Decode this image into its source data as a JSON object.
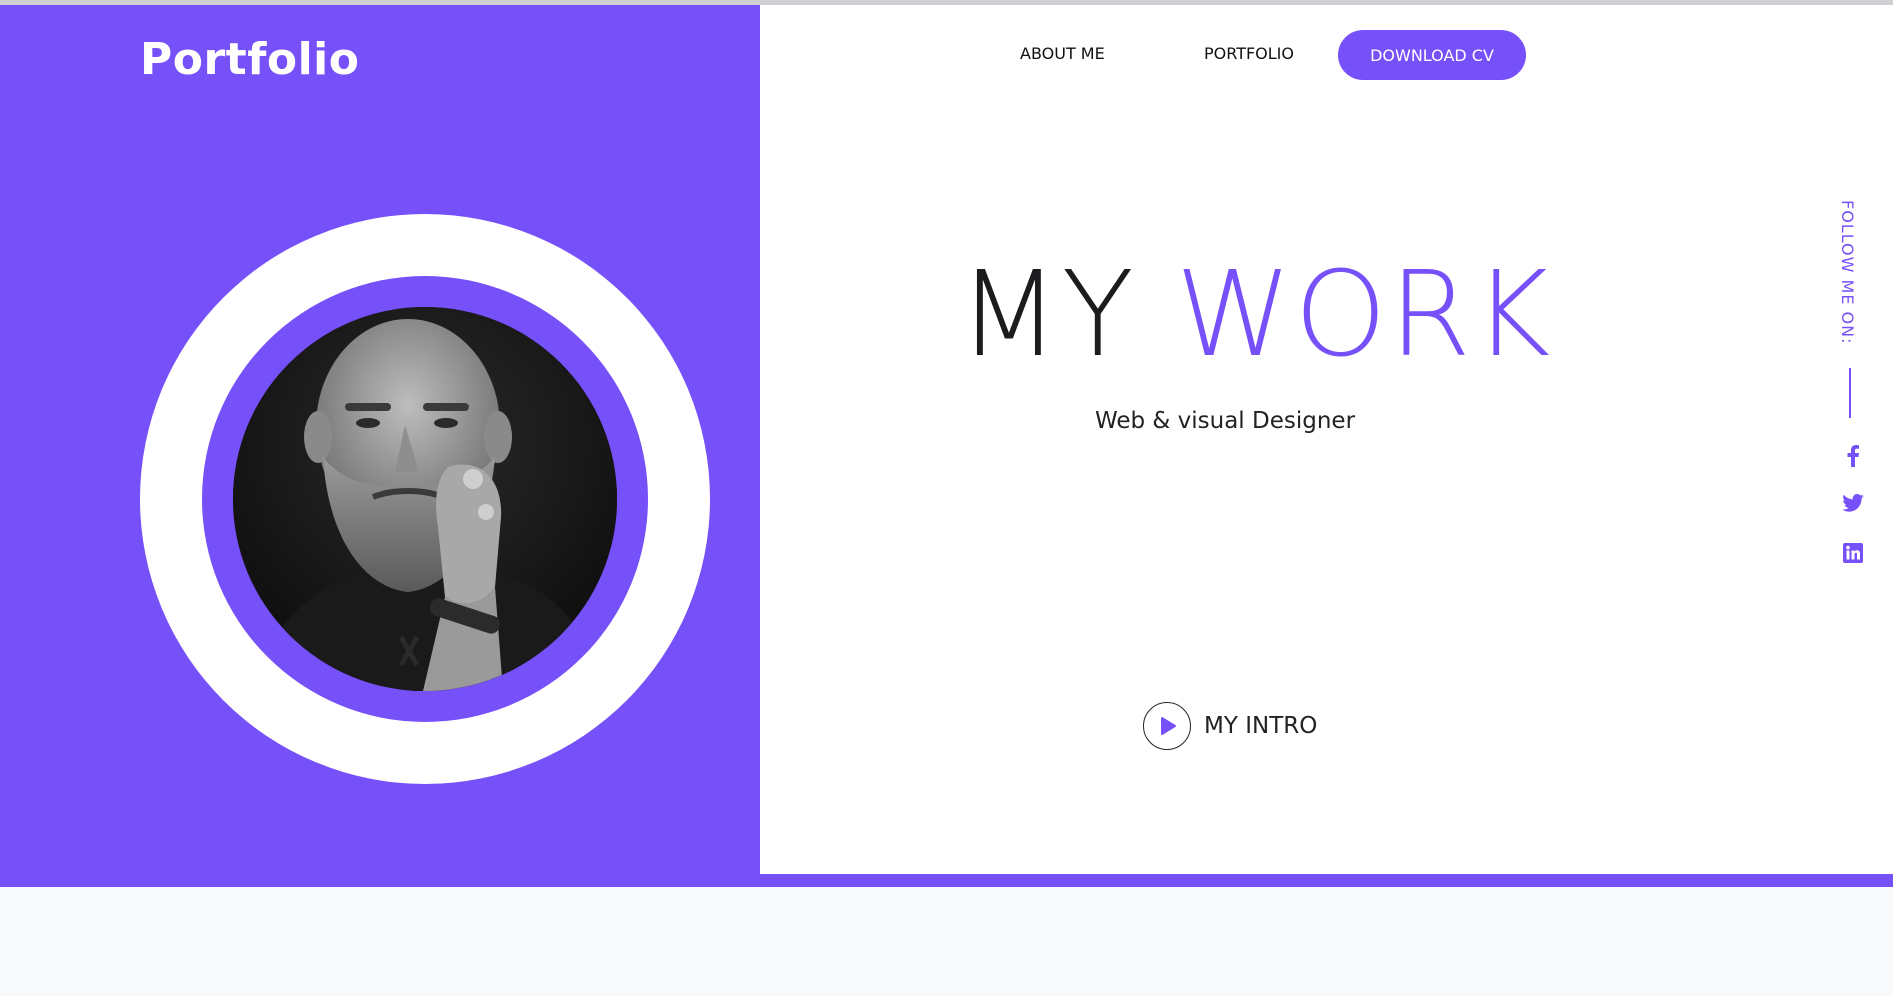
{
  "brand": {
    "title": "Portfolio"
  },
  "nav": {
    "about_label": "ABOUT ME",
    "portfolio_label": "PORTFOLIO",
    "download_cv_label": "DOWNLOAD CV"
  },
  "hero": {
    "title_part1": "MY",
    "title_part2": "WORK",
    "subtitle": "Web & visual Designer",
    "intro_label": "MY INTRO"
  },
  "social": {
    "follow_label": "FOLLOW ME ON:",
    "icons": [
      "facebook-icon",
      "twitter-icon",
      "linkedin-icon"
    ]
  },
  "colors": {
    "accent": "#7650f9",
    "text_dark": "#1c1c1f",
    "panel_white": "#ffffff"
  },
  "portrait": {
    "icon": "portrait-photo-bearded-man"
  }
}
